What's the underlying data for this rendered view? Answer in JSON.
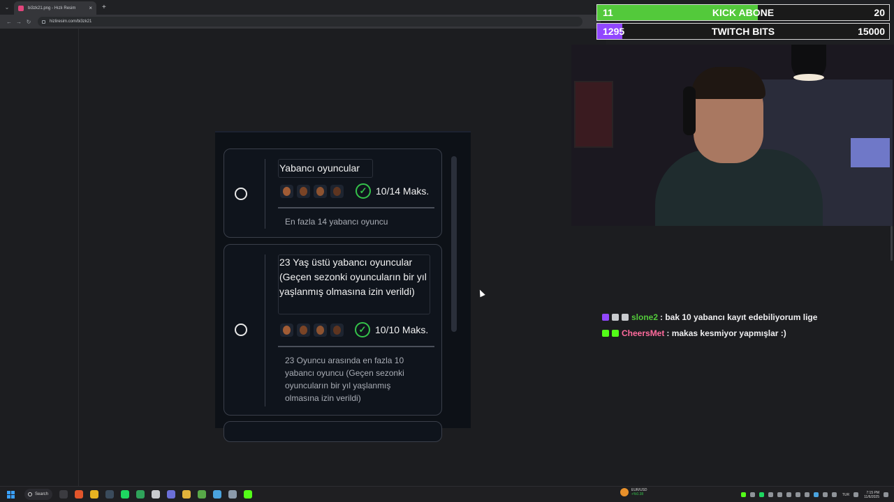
{
  "browser": {
    "tab_title": "bi3zk21.png - Hızlı Resim",
    "tab_close": "×",
    "new_tab": "+",
    "url": "hizliresim.com/bi3zk21",
    "nav_back": "←",
    "nav_forward": "→",
    "nav_reload": "↻",
    "tab_chevron": "⌄"
  },
  "cards": [
    {
      "title": "Yabancı oyuncular",
      "count": "10/14 Maks.",
      "description": "En fazla 14 yabancı oyuncu",
      "filled": 0.71
    },
    {
      "title": "23 Yaş üstü yabancı oyuncular (Geçen sezonki oyuncuların bir yıl yaşlanmış olmasına izin verildi)",
      "count": "10/10 Maks.",
      "description": "23 Oyuncu arasında en fazla 10 yabancı oyuncu (Geçen sezonki oyuncuların bir yıl yaşlanmış olmasına izin verildi)",
      "filled": 1.0
    }
  ],
  "goals": [
    {
      "current": "11",
      "title": "KICK ABONE",
      "target": "20",
      "progress": 0.55,
      "color": "#53c93b"
    },
    {
      "current": "1295",
      "title": "TWITCH BITS",
      "target": "15000",
      "progress": 0.086,
      "color": "#9147ff"
    }
  ],
  "chat": [
    {
      "user": "slone2",
      "message": ": bak 10 yabancı kayıt edebiliyorum lige",
      "user_color": "#53c93b",
      "badges": [
        "#9147ff",
        "#c9cbcf",
        "#c9cbcf"
      ]
    },
    {
      "user": "CheersMet",
      "message": ": makas kesmiyor yapmışlar :)",
      "user_color": "#ff6b9d",
      "badges": [
        "#53fc18",
        "#53fc18"
      ]
    }
  ],
  "taskbar": {
    "search_label": "Search",
    "currency_pair": "EUR/USD",
    "currency_change": "+%0.38",
    "language": "TUR",
    "time": "7:15 PM",
    "date": "11/6/2025"
  }
}
